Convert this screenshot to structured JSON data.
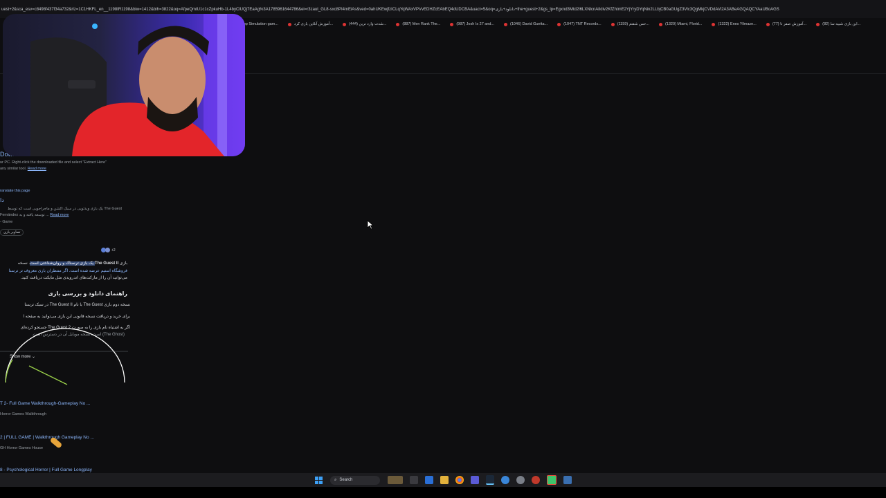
{
  "browser": {
    "url": "uest+2&sca_esv=c8498f437f34a732&rlz=1C1HKFL_en__1198IR1198&biw=1412&bih=3822&oq=AfpeQmtU1c1cZpkuHb-1L4byClUQj7EaAg%3A1785961644786&ei=r3zaut_GL8-sxc8PI4mEiAs&ved=0ahUKEwjfzICLqYqWAxVPVvEDHZcEAbEQ4dUDCBA&uact=5&oq=دانلود+بازی+the+guest+2&gs_lp=Egxnd3Mtd2l6LXNlcnAiIdiv2KfZhtmE2YjYryDYqNin2LLbjCB0aGUgZ3Vlc3QgMkjCVDdAVi2A3ABeAGQAQCYAaUBoAGS",
    "bookmarks": [
      "Top Simulation gam...",
      "آموزش آنلاین بازی کرد...",
      "(444) شدت وارد ترین...",
      "(887) Men Rank The...",
      "(987) Josh Is 27 and...",
      "(1046) David Guetta...",
      "(1047) TNT Records...",
      "(1159) حس شفتم...",
      "(1320) Miami, Florid...",
      "(1322) Enes Yilmaze...",
      "(77) آموزش صفر تا...",
      "(82) این بازی شبیه سا..."
    ]
  },
  "results": {
    "first_title": "Download",
    "first_snippet": "ur PC. Right-click the downloaded file and select \"Extract Here\"",
    "first_snippet2": "any similar tool.",
    "read_more": "Read more",
    "translate": "ranslate this page",
    "second_title": "دا",
    "second_snippet": "The Guest یک بازی ویدئویی در سبک اکشن و ماجراجویی است که توسط",
    "second_snippet2": "Fernández توسعه یافته و به ...",
    "second_snippet3": "- Game",
    "chip": "تصاویر بازی",
    "ai_badge": "+2",
    "ai_line1_pre": "بازی ",
    "ai_line1_bold": "The Guest II",
    "ai_line1_hl": " یک بازی ترسناک و روان‌شناختی است",
    "ai_line1_post": ". نسخه",
    "ai_line2": "فروشگاه استیم عرضه شده است. اگر منتظران بازی معروف تر ترسنا",
    "ai_line3": "می‌توانید آن را از مارکت‌های اندرویدی مثل مایکت دریافت کنید.",
    "ai_heading": "راهنمای دانلود و بررسی بازی",
    "bullet1": "نسخه دوم بازی The Guest با نام The Guest II در سبک ترسنا",
    "bullet2": "برای خرید و دریافت نسخه قانونی این بازی می‌توانید به صفحه ا",
    "bullet3": "اگر به اشتباه نام بازی را به صورت The Guest 2 جستجو کرده‌ای",
    "bullet3b": "(The Ghost) است. نسخه موبایل آن در دسترس است.",
    "show_more": "Show more",
    "videos": [
      {
        "title": "T 2- Full Game Walkthrough-Gameplay No ...",
        "source": "Horror Games Walkthrough"
      },
      {
        "title": "2 | FULL GAME | Walkthrough Gameplay No ...",
        "source": "GH Horror Games House"
      },
      {
        "title": "8 - Psychological Horror | Full Game Longplay",
        "source": ""
      }
    ]
  },
  "taskbar": {
    "search_label": "Search"
  },
  "colors": {
    "link": "#8ab4f8",
    "background": "#0e0e10",
    "highlight": "#3a4f7a"
  }
}
